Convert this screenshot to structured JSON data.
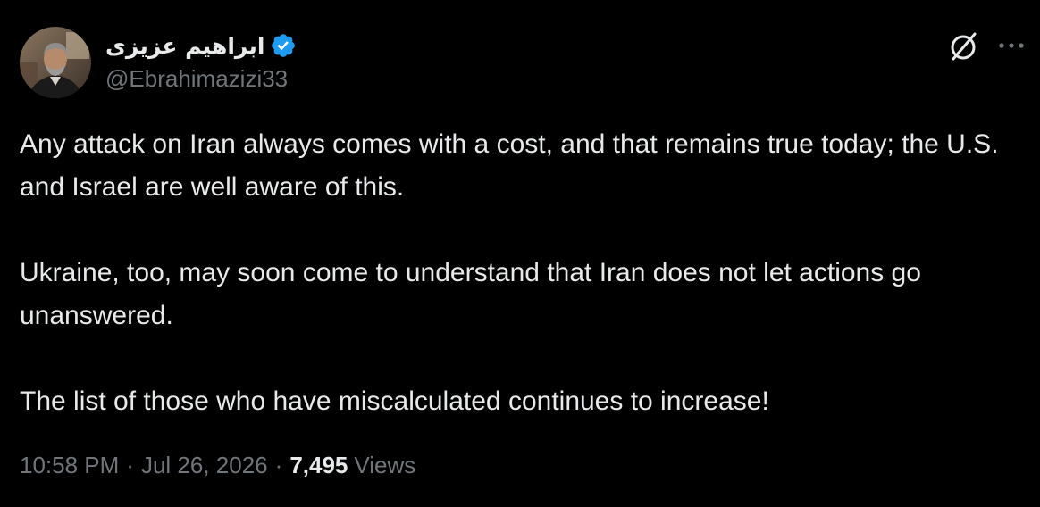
{
  "author": {
    "display_name": "ابراهیم عزیزی",
    "handle": "@Ebrahimazizi33",
    "verified": true,
    "verified_color": "#1d9bf0"
  },
  "tweet": {
    "paragraphs": [
      "Any attack on Iran always comes with a cost, and that remains true today; the U.S. and Israel are well aware of this.",
      "Ukraine, too, may soon come to understand that Iran does not let actions go unanswered.",
      "The list of those who have miscalculated continues to increase!"
    ]
  },
  "meta": {
    "time": "10:58 PM",
    "separator": "·",
    "date": "Jul 26, 2026",
    "views_count": "7,495",
    "views_label": "Views"
  },
  "actions": {
    "grok_icon": "grok-icon",
    "more_icon": "more-icon"
  },
  "colors": {
    "background": "#000000",
    "primary_text": "#e7e9ea",
    "secondary_text": "#71767b"
  }
}
